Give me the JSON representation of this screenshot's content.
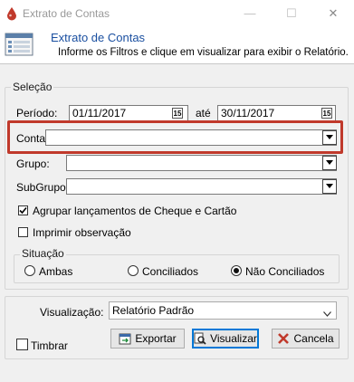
{
  "window": {
    "title": "Extrato de Contas",
    "minimize": "—",
    "maximize": "☐",
    "close": "✕"
  },
  "header": {
    "title": "Extrato de Contas",
    "subtitle": "Informe os Filtros e clique em visualizar para exibir o Relatório."
  },
  "selecao": {
    "legend": "Seleção",
    "periodo_label": "Período:",
    "periodo_inicio": "01/11/2017",
    "ate_label": "até",
    "periodo_fim": "30/11/2017",
    "date_btn": "15",
    "conta_label": "Conta:",
    "conta_value": "",
    "grupo_label": "Grupo:",
    "grupo_value": "",
    "subgrupo_label": "SubGrupo:",
    "subgrupo_value": "",
    "agrupar_label": "Agrupar lançamentos de Cheque e Cartão",
    "agrupar_checked": true,
    "imprimir_label": "Imprimir observação",
    "imprimir_checked": false,
    "situacao": {
      "legend": "Situação",
      "options": [
        "Ambas",
        "Conciliados",
        "Não Conciliados"
      ],
      "selected": "Não Conciliados"
    }
  },
  "footer": {
    "visualizacao_label": "Visualização:",
    "visualizacao_value": "Relatório Padrão",
    "timbrar_label": "Timbrar",
    "exportar_label": "Exportar",
    "visualizar_label": "Visualizar",
    "cancela_label": "Cancela"
  },
  "colors": {
    "highlight": "#c0392b",
    "header_title": "#1a4fa0",
    "cancel_icon": "#c0392b"
  }
}
